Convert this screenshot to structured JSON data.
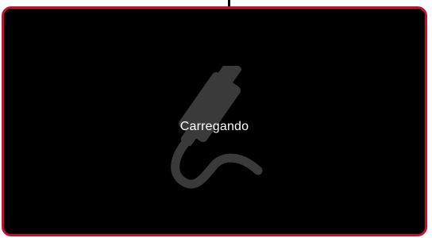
{
  "loading": {
    "text": "Carregando",
    "icon": "cable-plug-icon"
  },
  "colors": {
    "frame_border": "#c8102e",
    "screen_background": "#000000",
    "icon": "#3a3a3a",
    "text": "#ffffff"
  }
}
